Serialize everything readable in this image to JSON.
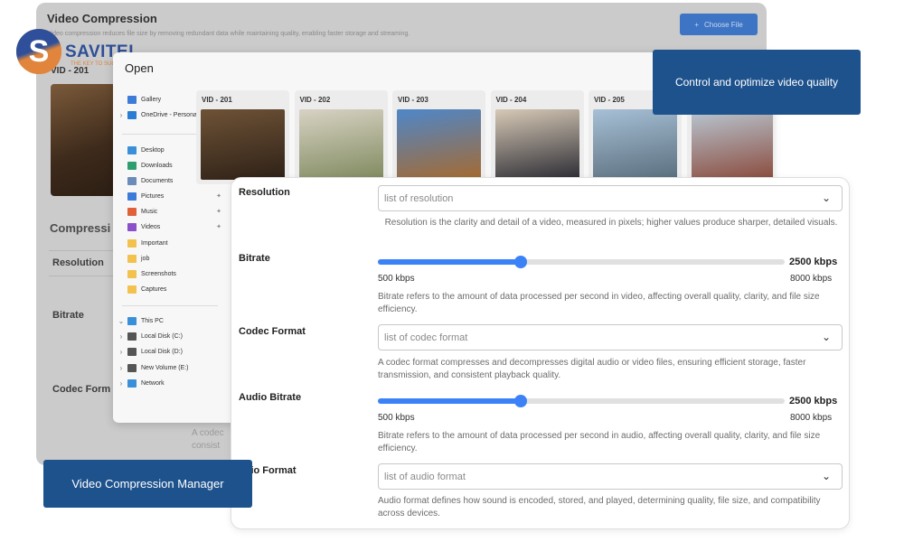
{
  "background_page": {
    "title": "Video Compression",
    "subtitle": "Video compression reduces file size by removing redundant data while maintaining quality, enabling faster storage and streaming.",
    "choose_file_label": "Choose File",
    "vid_label": "VID - 201",
    "section_title": "Compressi",
    "labels": [
      "Resolution",
      "Bitrate",
      "Codec Form"
    ],
    "codec_desc_partial": [
      "A codec",
      "consist"
    ]
  },
  "logo": {
    "text": "SAVITEL",
    "tagline": "THE KEY TO SUCCESS"
  },
  "dialog": {
    "title": "Open",
    "nav": [
      {
        "label": "Gallery",
        "icon": "gallery-icon",
        "color": "#3d7bd9",
        "chev": false,
        "pin": false
      },
      {
        "label": "OneDrive - Persona",
        "icon": "cloud-icon",
        "color": "#2b7cd3",
        "chev": true,
        "pin": false
      },
      {
        "label": "Desktop",
        "icon": "desktop-icon",
        "color": "#3a8fd9",
        "chev": false,
        "pin": true
      },
      {
        "label": "Downloads",
        "icon": "download-icon",
        "color": "#2f9e6e",
        "chev": false,
        "pin": true
      },
      {
        "label": "Documents",
        "icon": "document-icon",
        "color": "#6b8bb8",
        "chev": false,
        "pin": true
      },
      {
        "label": "Pictures",
        "icon": "picture-icon",
        "color": "#3d7bd9",
        "chev": false,
        "pin": true
      },
      {
        "label": "Music",
        "icon": "music-icon",
        "color": "#e0603a",
        "chev": false,
        "pin": true
      },
      {
        "label": "Videos",
        "icon": "video-icon",
        "color": "#8a4fc9",
        "chev": false,
        "pin": true
      },
      {
        "label": "Important",
        "icon": "folder-icon",
        "color": "#f2c14e",
        "chev": false,
        "pin": false
      },
      {
        "label": "job",
        "icon": "folder-icon",
        "color": "#f2c14e",
        "chev": false,
        "pin": false
      },
      {
        "label": "Screenshots",
        "icon": "folder-icon",
        "color": "#f2c14e",
        "chev": false,
        "pin": false
      },
      {
        "label": "Captures",
        "icon": "folder-icon",
        "color": "#f2c14e",
        "chev": false,
        "pin": false
      },
      {
        "label": "This PC",
        "icon": "pc-icon",
        "color": "#3a8fd9",
        "chev": true,
        "pin": false
      },
      {
        "label": "Local Disk (C:)",
        "icon": "disk-icon",
        "color": "#555555",
        "chev": true,
        "pin": false
      },
      {
        "label": "Local Disk (D:)",
        "icon": "disk-icon",
        "color": "#555555",
        "chev": true,
        "pin": false
      },
      {
        "label": "New Volume (E:)",
        "icon": "disk-icon",
        "color": "#555555",
        "chev": true,
        "pin": false
      },
      {
        "label": "Network",
        "icon": "network-icon",
        "color": "#3a8fd9",
        "chev": true,
        "pin": false
      }
    ],
    "videos": [
      {
        "label": "VID - 201",
        "colors": [
          "#6e5236",
          "#2e2117"
        ]
      },
      {
        "label": "VID - 202",
        "colors": [
          "#d8d2c4",
          "#7f8a5e"
        ]
      },
      {
        "label": "VID - 203",
        "colors": [
          "#4e87c9",
          "#a66a2f"
        ]
      },
      {
        "label": "VID - 204",
        "colors": [
          "#d7c9b6",
          "#2b2b33"
        ]
      },
      {
        "label": "VID - 205",
        "colors": [
          "#a7c0d6",
          "#5a6e7d"
        ]
      },
      {
        "label": "",
        "colors": [
          "#b9c8d4",
          "#8a4a3c"
        ]
      }
    ]
  },
  "settings": {
    "resolution": {
      "label": "Resolution",
      "placeholder": "list of resolution",
      "desc": "Resolution is the clarity and detail of a video, measured in pixels; higher values produce sharper, detailed visuals."
    },
    "bitrate": {
      "label": "Bitrate",
      "value": "2500 kbps",
      "min": "500 kbps",
      "max": "8000 kbps",
      "fraction": 0.35,
      "desc": "Bitrate refers to the amount of data processed per second in video, affecting overall quality, clarity, and file size efficiency."
    },
    "codec": {
      "label": "Codec Format",
      "placeholder": "list of codec format",
      "desc": "A codec format compresses and decompresses digital audio or video files, ensuring efficient storage, faster transmission, and consistent playback quality."
    },
    "audio_bitrate": {
      "label": "Audio Bitrate",
      "value": "2500 kbps",
      "min": "500 kbps",
      "max": "8000 kbps",
      "fraction": 0.35,
      "desc": "Bitrate refers to the amount of data processed per second in audio, affecting overall quality, clarity, and file size efficiency."
    },
    "audio_format": {
      "label": "udio Format",
      "placeholder": "list of audio format",
      "desc": "Audio format defines how sound is encoded, stored, and played, determining quality, file size, and compatibility across devices."
    }
  },
  "callouts": {
    "top_right": "Control and optimize video quality",
    "bottom_left": "Video Compression Manager"
  }
}
